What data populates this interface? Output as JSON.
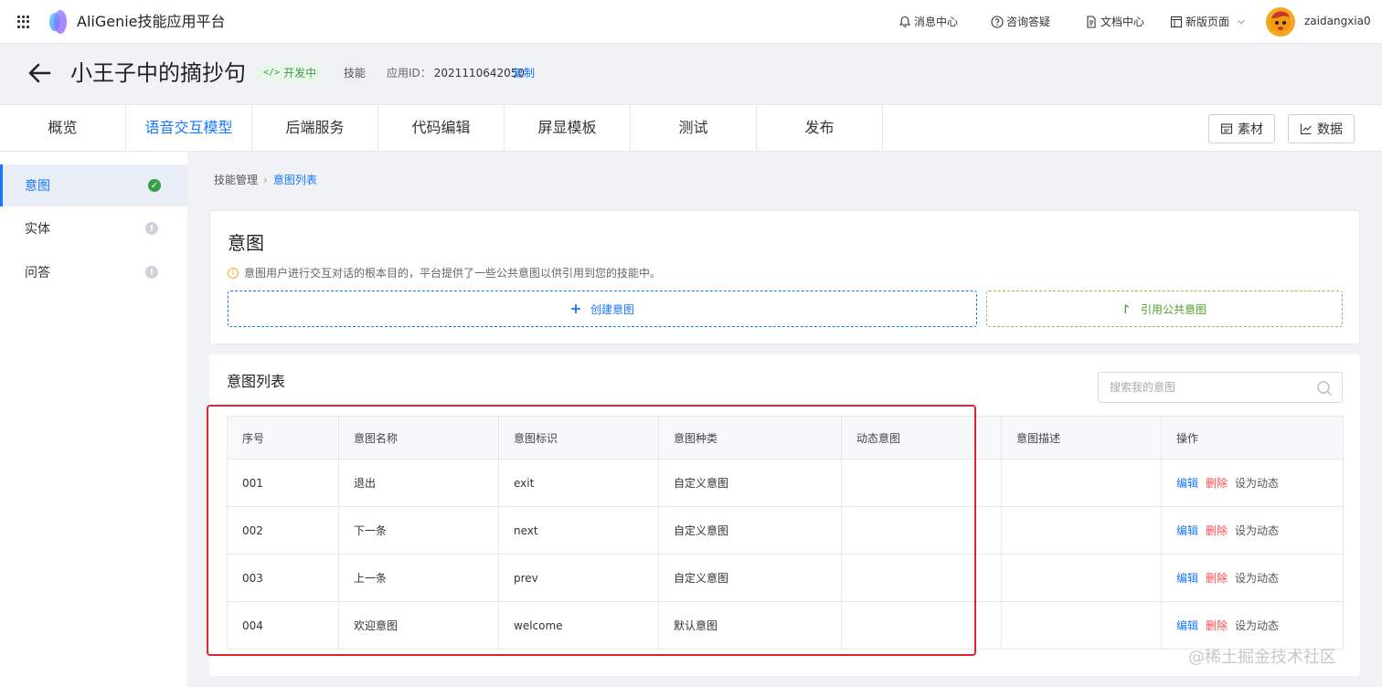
{
  "header": {
    "app_title": "AliGenie技能应用平台",
    "links": [
      {
        "label": "消息中心",
        "icon": "bell-icon"
      },
      {
        "label": "咨询答疑",
        "icon": "question-circle-icon"
      },
      {
        "label": "文档中心",
        "icon": "document-icon"
      },
      {
        "label": "新版页面",
        "icon": "layout-icon"
      }
    ],
    "username": "zaidangxia0"
  },
  "title_area": {
    "title": "小王子中的摘抄句",
    "status_badge": "开发中",
    "type_badge": "技能",
    "app_id_label": "应用ID：",
    "app_id": "2021110642050",
    "copy_label": "复制"
  },
  "tabs": [
    {
      "label": "概览"
    },
    {
      "label": "语音交互模型",
      "active": true
    },
    {
      "label": "后端服务"
    },
    {
      "label": "代码编辑"
    },
    {
      "label": "屏显模板"
    },
    {
      "label": "测试"
    },
    {
      "label": "发布"
    }
  ],
  "toolbar": {
    "material_label": "素材",
    "data_label": "数据"
  },
  "sidebar": {
    "items": [
      {
        "label": "意图",
        "status": "done",
        "active": true
      },
      {
        "label": "实体",
        "status": "todo"
      },
      {
        "label": "问答",
        "status": "todo"
      }
    ]
  },
  "breadcrumb": {
    "parent": "技能管理",
    "current": "意图列表"
  },
  "intent_card": {
    "title": "意图",
    "tip": "意图用户进行交互对话的根本目的，平台提供了一些公共意图以供引用到您的技能中。",
    "create_label": "创建意图",
    "import_label": "引用公共意图"
  },
  "list": {
    "title": "意图列表",
    "search_placeholder": "搜索我的意图",
    "columns": [
      "序号",
      "意图名称",
      "意图标识",
      "意图种类",
      "动态意图",
      "意图描述",
      "操作"
    ],
    "rows": [
      {
        "no": "001",
        "name": "退出",
        "id": "exit",
        "kind": "自定义意图",
        "dynamic": "",
        "desc": ""
      },
      {
        "no": "002",
        "name": "下一条",
        "id": "next",
        "kind": "自定义意图",
        "dynamic": "",
        "desc": ""
      },
      {
        "no": "003",
        "name": "上一条",
        "id": "prev",
        "kind": "自定义意图",
        "dynamic": "",
        "desc": ""
      },
      {
        "no": "004",
        "name": "欢迎意图",
        "id": "welcome",
        "kind": "默认意图",
        "dynamic": "",
        "desc": ""
      }
    ],
    "actions": {
      "edit": "编辑",
      "delete": "删除",
      "set_dynamic": "设为动态"
    }
  },
  "watermark": "@稀土掘金技术社区",
  "colors": {
    "accent": "#1677ff",
    "success": "#3a9c4a",
    "danger": "#ff4d4f",
    "highlight": "#e0252c"
  }
}
